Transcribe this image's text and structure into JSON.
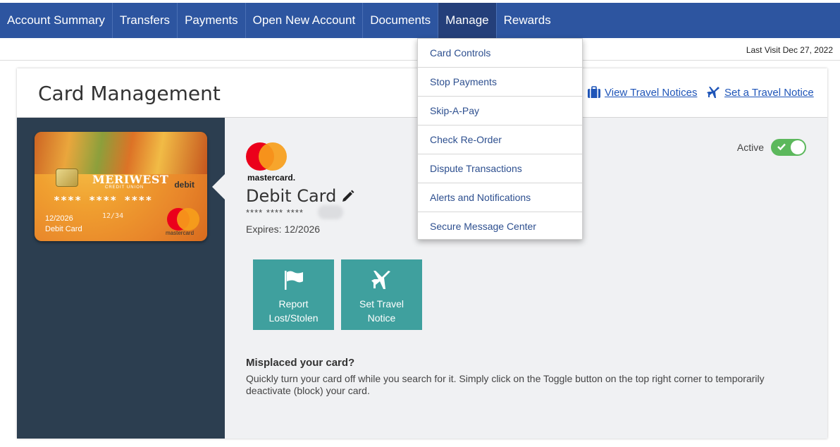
{
  "nav": {
    "items": [
      {
        "label": "Account Summary"
      },
      {
        "label": "Transfers"
      },
      {
        "label": "Payments"
      },
      {
        "label": "Open New Account"
      },
      {
        "label": "Documents"
      },
      {
        "label": "Manage"
      },
      {
        "label": "Rewards"
      }
    ],
    "active": "Manage"
  },
  "visit": {
    "text": "Last Visit Dec 27, 2022"
  },
  "manage_menu": {
    "items": [
      {
        "label": "Card Controls"
      },
      {
        "label": "Stop Payments"
      },
      {
        "label": "Skip-A-Pay"
      },
      {
        "label": "Check Re-Order"
      },
      {
        "label": "Dispute Transactions"
      },
      {
        "label": "Alerts and Notifications"
      },
      {
        "label": "Secure Message Center"
      }
    ]
  },
  "page": {
    "title": "Card Management",
    "view_travel_label": "View Travel Notices",
    "set_travel_label": "Set a Travel Notice"
  },
  "card_image": {
    "brand": "MERIWEST",
    "brand_sub": "CREDIT UNION",
    "type": "debit",
    "number": "**** **** ****",
    "exp": "12/2026",
    "valid_thru": "12/34",
    "name": "Debit Card",
    "network": "mastercard"
  },
  "card": {
    "network_label": "mastercard.",
    "name": "Debit Card",
    "masked_number": "**** **** ****",
    "expires": "Expires: 12/2026",
    "status_label": "Active",
    "active": true
  },
  "actions": {
    "report_label": "Report\nLost/Stolen",
    "travel_label": "Set Travel\nNotice"
  },
  "help": {
    "title": "Misplaced your card?",
    "text": "Quickly turn your card off while you search for it. Simply click on the Toggle button on the top right corner to temporarily deactivate (block) your card."
  },
  "colors": {
    "nav_bg": "#2d55a0",
    "nav_active": "#243f7a",
    "sidebar": "#2c3e50",
    "action_teal": "#3fa09e",
    "toggle_green": "#5cb85c",
    "link_blue": "#1f55b8",
    "mastercard_red": "#eb001b",
    "mastercard_orange": "#f79e1b"
  },
  "icons": [
    "briefcase-icon",
    "airplane-icon",
    "pencil-icon",
    "flag-icon",
    "check-icon",
    "mastercard-logo"
  ]
}
